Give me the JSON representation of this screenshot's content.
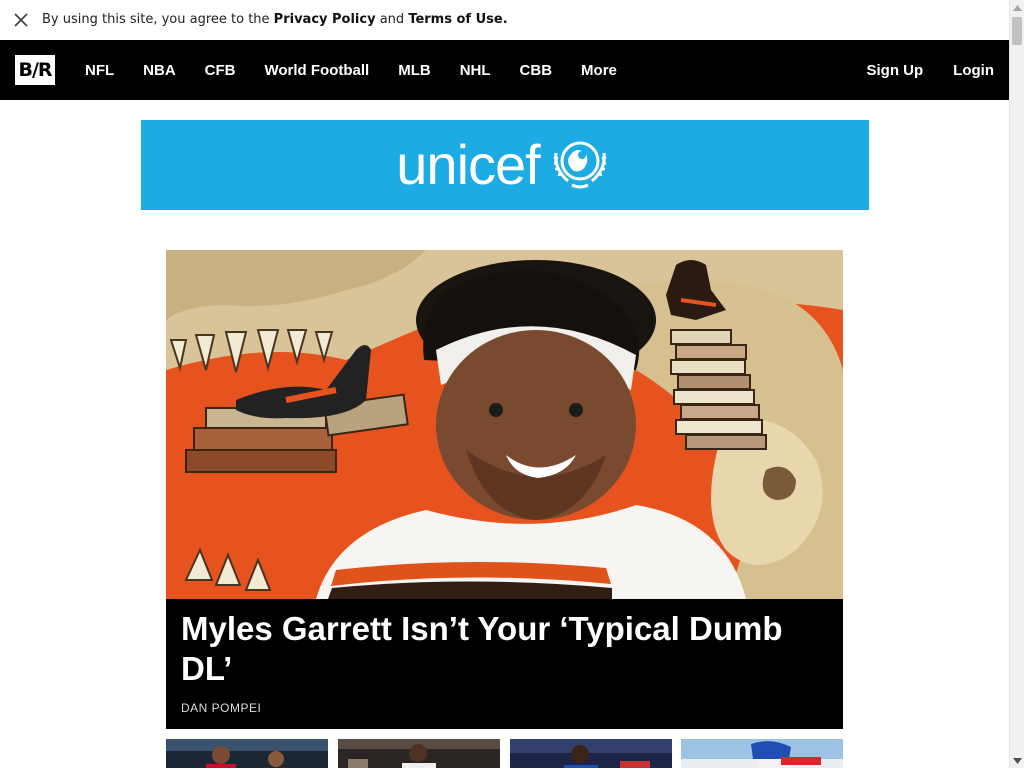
{
  "consent": {
    "prefix": "By using this site, you agree to the ",
    "privacy": "Privacy Policy",
    "and": " and ",
    "terms": "Terms of Use."
  },
  "nav": {
    "logo": "B/R",
    "items": [
      "NFL",
      "NBA",
      "CFB",
      "World Football",
      "MLB",
      "NHL",
      "CBB",
      "More"
    ],
    "sign_up": "Sign Up",
    "login": "Login"
  },
  "ad": {
    "brand": "unicef",
    "color": "#1cabe2"
  },
  "hero": {
    "title": "Myles Garrett Isn’t Your ‘Typical Dumb DL’",
    "author": "DAN POMPEI"
  },
  "colors": {
    "nav_bg": "#000000",
    "hero_bg": "#e6531f"
  }
}
